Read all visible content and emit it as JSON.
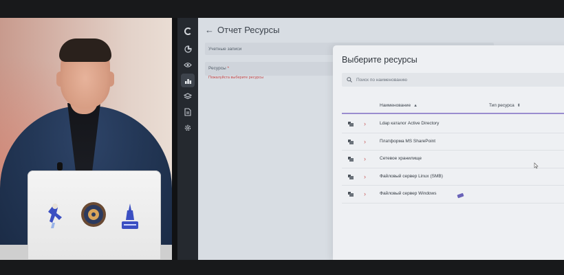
{
  "app": {
    "page_title": "Отчет Ресурсы",
    "rail_icons": [
      "loader-logo-icon",
      "dashboard-icon",
      "eye-icon",
      "reports-icon",
      "layers-icon",
      "document-icon",
      "settings-icon"
    ],
    "active_rail_icon": "reports-icon"
  },
  "form": {
    "accounts_label": "Учетные записи",
    "resources_label": "Ресурсы",
    "required_marker": "*",
    "resources_error": "Пожалуйста выберите ресурсы"
  },
  "modal": {
    "title": "Выберите ресурсы",
    "search_placeholder": "Поиск по наименованию",
    "columns": {
      "name": "Наименование",
      "type": "Тип ресурса"
    },
    "rows": [
      {
        "name": "Ldap каталог Active Directory"
      },
      {
        "name": "Платформа MS SharePoint"
      },
      {
        "name": "Сетевое хранилище"
      },
      {
        "name": "Файловый сервер Linux (SMB)"
      },
      {
        "name": "Файловый сервер Windows"
      }
    ]
  },
  "colors": {
    "accent_underline": "#9a8ccf",
    "error": "#c64848",
    "rail_bg": "#25292f"
  }
}
